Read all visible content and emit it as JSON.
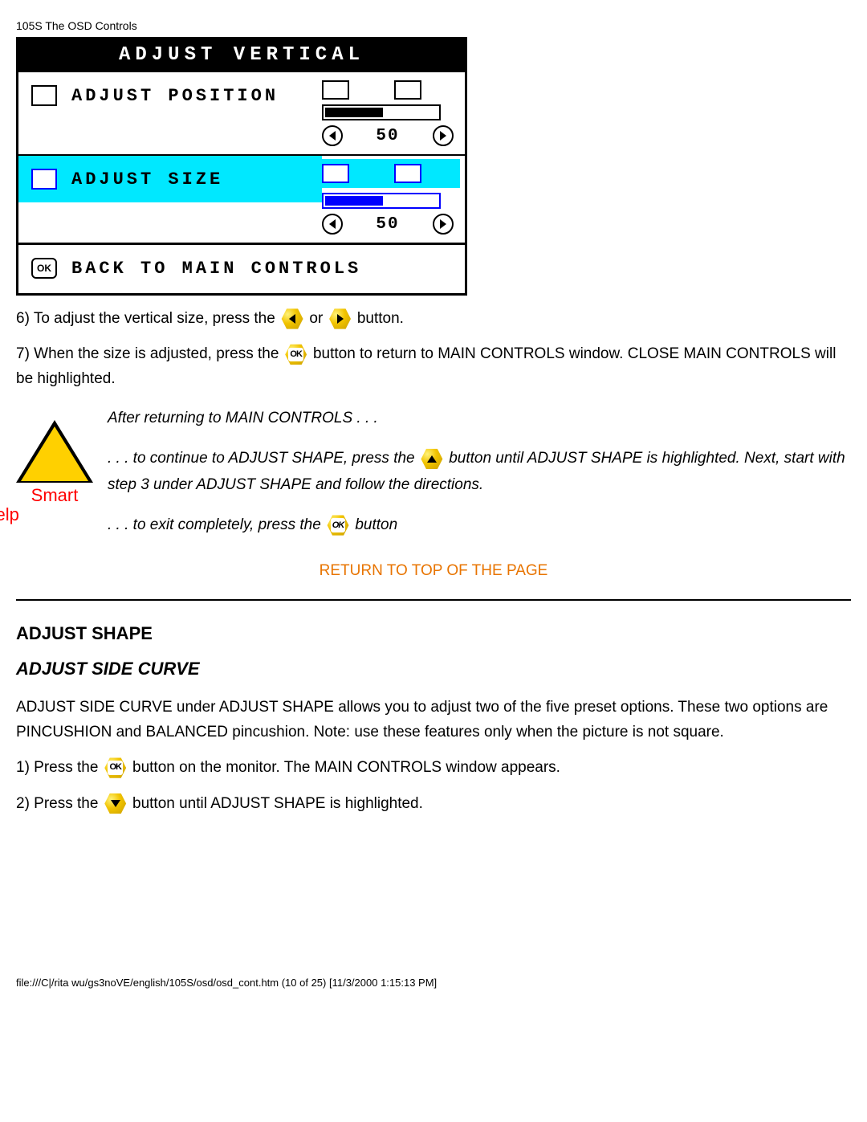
{
  "header": "105S The OSD Controls",
  "osd": {
    "title": "ADJUST VERTICAL",
    "row1_label": "ADJUST POSITION",
    "row1_value": "50",
    "row2_label": "ADJUST SIZE",
    "row2_value": "50",
    "back_label": "BACK TO MAIN CONTROLS",
    "ok_text": "OK"
  },
  "step6_a": "6) To adjust the vertical size, press the",
  "step6_b": "or",
  "step6_c": "button.",
  "step7_a": "7) When the size is adjusted, press the ",
  "step7_b": "button to return to MAIN CONTROLS window. CLOSE MAIN CONTROLS will be highlighted.",
  "smart_help_label1": "Smart",
  "smart_help_label2": "Help",
  "tip_line1": "After returning to MAIN CONTROLS . . .",
  "tip_line2a": ". . . to continue to ADJUST SHAPE, press the ",
  "tip_line2b": "button until ADJUST SHAPE is highlighted. Next, start with step 3 under ADJUST SHAPE and follow the directions.",
  "tip_line3a": ". . . to exit completely, press the ",
  "tip_line3b": "button",
  "return_link": "RETURN TO TOP OF THE PAGE",
  "section_heading": "ADJUST SHAPE",
  "sub_heading": "ADJUST SIDE CURVE",
  "desc": "ADJUST SIDE CURVE under ADJUST SHAPE allows you to adjust two of the five preset options. These two options are PINCUSHION and BALANCED pincushion. Note: use these features only when the picture is not square.",
  "step1_a": "1) Press the ",
  "step1_b": "button on the monitor. The MAIN CONTROLS window appears.",
  "step2_a": "2) Press the ",
  "step2_b": "button until ADJUST SHAPE is highlighted.",
  "footer": "file:///C|/rita wu/gs3noVE/english/105S/osd/osd_cont.htm (10 of 25) [11/3/2000 1:15:13 PM]"
}
